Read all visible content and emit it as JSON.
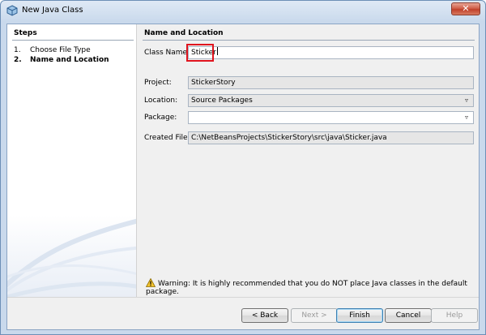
{
  "window": {
    "title": "New Java Class",
    "close_icon": "close-icon",
    "app_icon": "netbeans-cube-icon"
  },
  "steps": {
    "title": "Steps",
    "items": [
      {
        "num": "1.",
        "label": "Choose File Type"
      },
      {
        "num": "2.",
        "label": "Name and Location"
      }
    ]
  },
  "form": {
    "title": "Name and Location",
    "class_name_label": "Class Name:",
    "class_name_value": "Sticker",
    "project_label": "Project:",
    "project_value": "StickerStory",
    "location_label": "Location:",
    "location_value": "Source Packages",
    "package_label": "Package:",
    "package_value": "",
    "created_file_label": "Created File:",
    "created_file_value": "C:\\NetBeansProjects\\StickerStory\\src\\java\\Sticker.java"
  },
  "warning": {
    "icon": "warning-triangle-icon",
    "text": "Warning: It is highly recommended that you do NOT place Java classes in the default package."
  },
  "buttons": {
    "back": "< Back",
    "next": "Next >",
    "finish": "Finish",
    "cancel": "Cancel",
    "help": "Help"
  },
  "colors": {
    "highlight": "#e0141e",
    "title_bar": "#c9d9ec",
    "close_button": "#c0402a"
  }
}
